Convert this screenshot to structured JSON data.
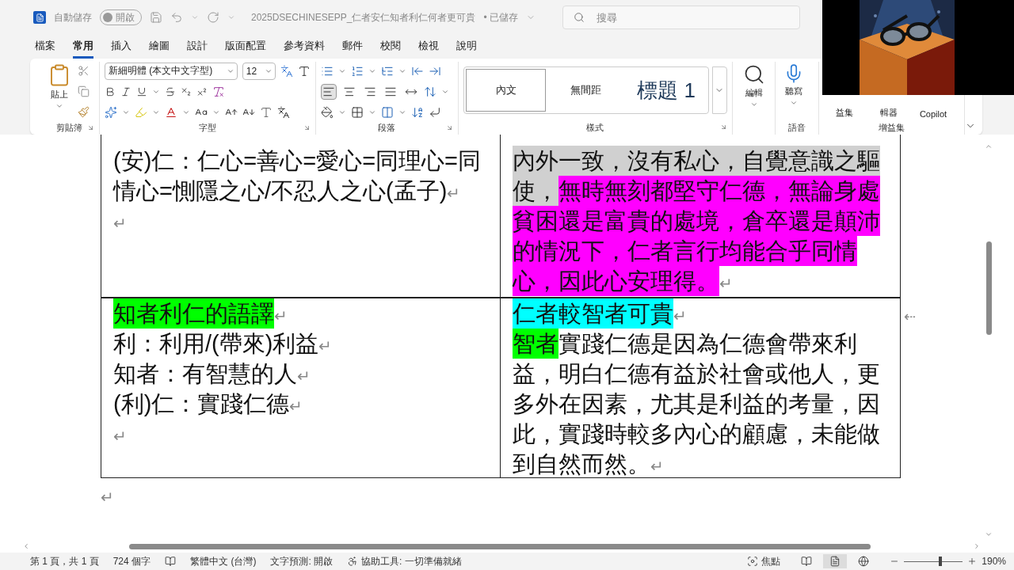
{
  "title_bar": {
    "autosave_label": "自動儲存",
    "autosave_toggle": {
      "label": "開啟",
      "on": false
    },
    "filename": "2025DSECHINESEPP_仁者安仁知者利仁何者更可貴",
    "save_state": "• 已儲存",
    "search": {
      "placeholder": "搜尋"
    }
  },
  "menu_tabs": [
    {
      "label": "檔案",
      "selected": false
    },
    {
      "label": "常用",
      "selected": true
    },
    {
      "label": "插入",
      "selected": false
    },
    {
      "label": "繪圖",
      "selected": false
    },
    {
      "label": "設計",
      "selected": false
    },
    {
      "label": "版面配置",
      "selected": false
    },
    {
      "label": "參考資料",
      "selected": false
    },
    {
      "label": "郵件",
      "selected": false
    },
    {
      "label": "校閱",
      "selected": false
    },
    {
      "label": "檢視",
      "selected": false
    },
    {
      "label": "說明",
      "selected": false
    }
  ],
  "ribbon": {
    "clipboard": {
      "paste": "貼上",
      "label": "剪貼簿"
    },
    "font": {
      "font_name": "新細明體 (本文中文字型)",
      "font_size": "12",
      "label": "字型"
    },
    "paragraph": {
      "label": "段落",
      "alignments": [
        {
          "kind": "left",
          "selected": true
        },
        {
          "kind": "center",
          "selected": false
        },
        {
          "kind": "right",
          "selected": false
        },
        {
          "kind": "justify",
          "selected": false
        },
        {
          "kind": "distributed",
          "selected": false
        }
      ]
    },
    "styles": {
      "label": "樣式",
      "items": [
        {
          "label": "內文",
          "kind": "body",
          "selected": true
        },
        {
          "label": "無間距",
          "kind": "body",
          "selected": false
        },
        {
          "label": "標題 1",
          "kind": "heading",
          "selected": false
        }
      ]
    },
    "editing": {
      "label": "編輯"
    },
    "voice": {
      "dictate": "聽寫",
      "label": "語音"
    },
    "addins": {
      "buttons": [
        "益集",
        "輯器",
        "Copilot"
      ],
      "label": "增益集"
    }
  },
  "document": {
    "rows": [
      {
        "cells": [
          {
            "paragraphs": [
              {
                "lines": [
                  [
                    {
                      "text": "(安)仁：仁心=善心=愛心=同理心=同"
                    }
                  ],
                  [
                    {
                      "text": "情心=惻隱之心/不忍人之心(孟子)"
                    }
                  ]
                ],
                "mark": "↵"
              },
              {
                "mark": "↵"
              }
            ]
          },
          {
            "paragraphs": [
              {
                "lines": [
                  [
                    {
                      "text": "內外一致，沒有私心，自覺意識之驅",
                      "color": "#d0d0d0"
                    }
                  ],
                  [
                    {
                      "text": "使，",
                      "color": "#d0d0d0"
                    },
                    {
                      "text": "無時無刻都堅守仁德，無論身處",
                      "color": "#ff00ff"
                    }
                  ],
                  [
                    {
                      "text": "貧困還是富貴的處境，倉卒還是顛沛",
                      "color": "#ff00ff"
                    }
                  ],
                  [
                    {
                      "text": "的情況下，仁者言行均能合乎同情",
                      "color": "#ff00ff"
                    }
                  ],
                  [
                    {
                      "text": "心，因此心安理得。",
                      "color": "#ff00ff"
                    }
                  ]
                ],
                "mark": "↵"
              }
            ]
          }
        ]
      },
      {
        "cells": [
          {
            "paragraphs": [
              {
                "lines": [
                  [
                    {
                      "text": "知者利仁的語譯",
                      "color": "#00ff00"
                    }
                  ]
                ],
                "mark": "↵"
              },
              {
                "lines": [
                  [
                    {
                      "text": "利：利用/(帶來)利益"
                    }
                  ]
                ],
                "mark": "↵"
              },
              {
                "lines": [
                  [
                    {
                      "text": "知者：有智慧的人"
                    }
                  ]
                ],
                "mark": "↵"
              },
              {
                "lines": [
                  [
                    {
                      "text": "(利)仁：實踐仁德"
                    }
                  ]
                ],
                "mark": "↵"
              },
              {
                "mark": "↵"
              }
            ]
          },
          {
            "paragraphs": [
              {
                "lines": [
                  [
                    {
                      "text": "仁者較智者可貴",
                      "color": "#00ffff"
                    }
                  ]
                ],
                "mark": "↵"
              },
              {
                "lines": [
                  [
                    {
                      "text": "智者",
                      "color": "#00ff00"
                    },
                    {
                      "text": "實踐仁德是因為仁德會帶來利"
                    }
                  ],
                  [
                    {
                      "text": "益，明白仁德有益於社會或他人，更"
                    }
                  ],
                  [
                    {
                      "text": "多外在因素，尤其是利益的考量，因"
                    }
                  ],
                  [
                    {
                      "text": "此，實踐時較多內心的顧慮，未能做"
                    }
                  ],
                  [
                    {
                      "text": "到自然而然。"
                    }
                  ]
                ],
                "mark": "↵"
              }
            ]
          }
        ],
        "end_mark": "⇠"
      }
    ],
    "after_table_mark": "↵"
  },
  "status_bar": {
    "page": "第 1 頁，共 1 頁",
    "words": "724 個字",
    "language": "繁體中文 (台灣)",
    "prediction": "文字預測: 開啟",
    "accessibility": "協助工具: 一切準備就緒",
    "focus": "焦點",
    "views": [
      {
        "kind": "read",
        "selected": false
      },
      {
        "kind": "print",
        "selected": true
      },
      {
        "kind": "web",
        "selected": false
      }
    ],
    "zoom": {
      "level": 0.62,
      "reading": "190%"
    }
  }
}
